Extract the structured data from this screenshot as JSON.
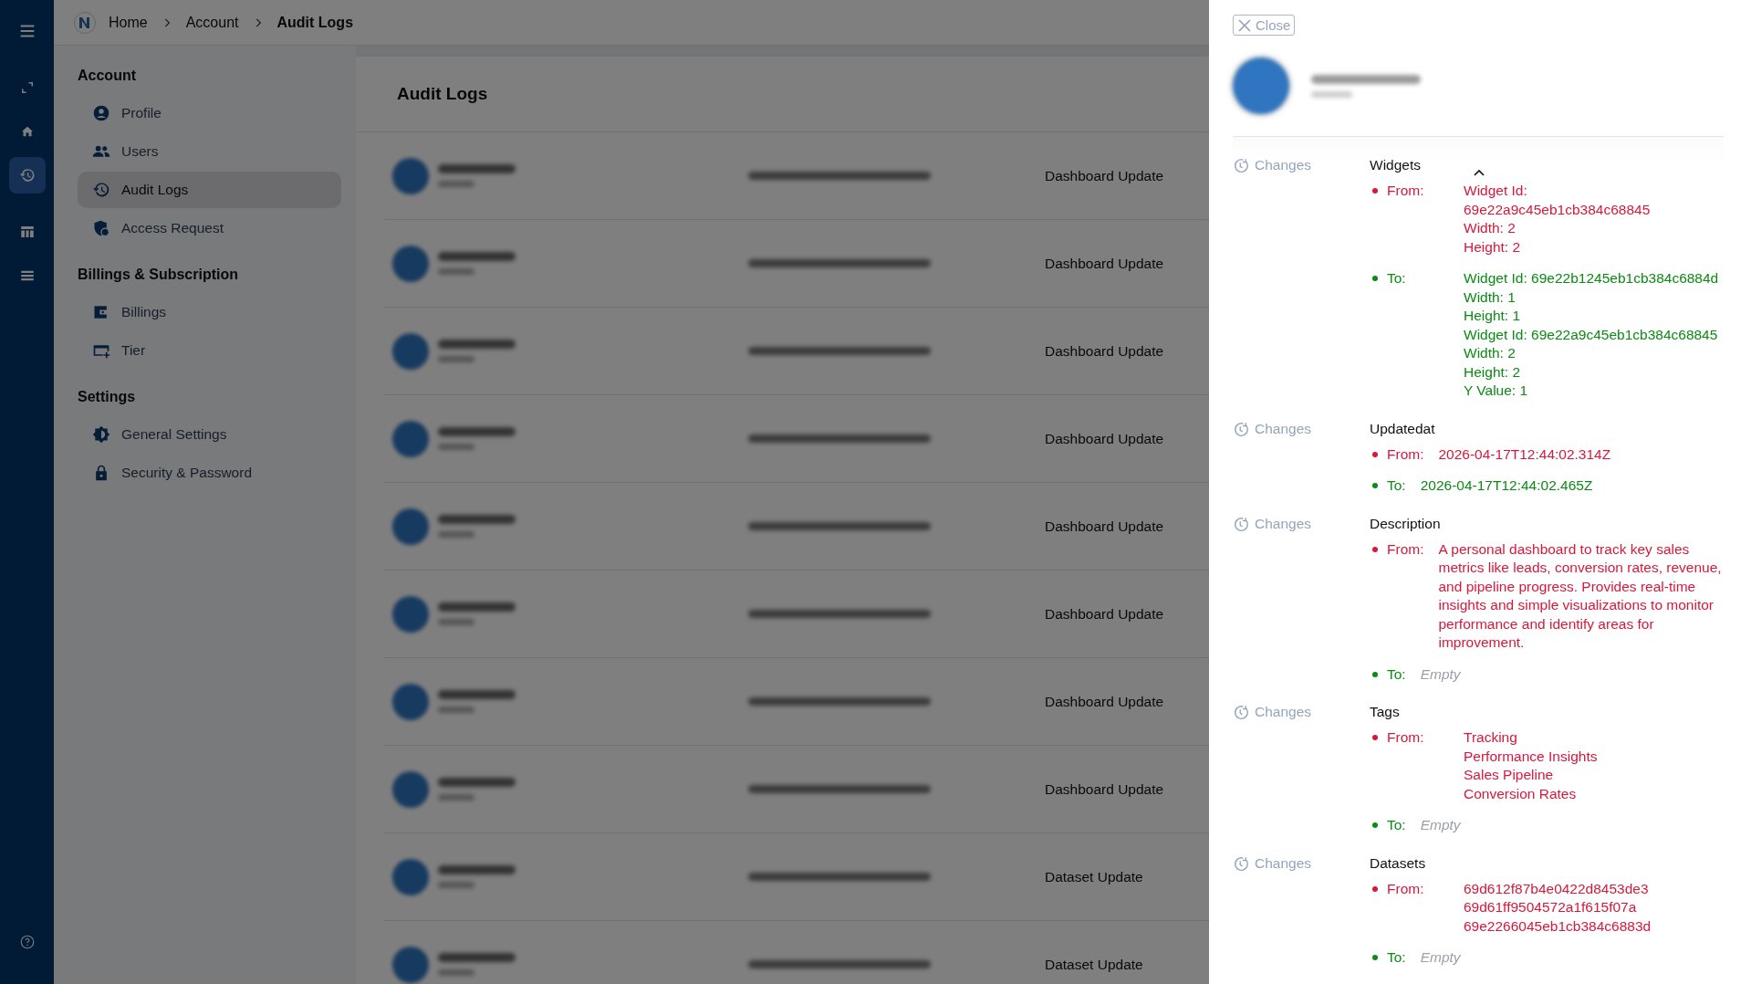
{
  "rail": [
    {
      "kind": "menu",
      "selected": false
    },
    {
      "kind": "expand",
      "selected": false
    },
    {
      "kind": "home",
      "selected": false
    },
    {
      "kind": "history",
      "selected": true
    },
    {
      "kind": "table",
      "selected": false
    },
    {
      "kind": "list",
      "selected": false
    },
    {
      "kind": "help",
      "selected": false
    }
  ],
  "breadcrumb": [
    {
      "label": "Home",
      "current": false
    },
    {
      "label": "Account",
      "current": false
    },
    {
      "label": "Audit Logs",
      "current": true
    }
  ],
  "sidebar": [
    {
      "title": "Account",
      "items": [
        {
          "label": "Profile",
          "kind": "profile",
          "selected": false
        },
        {
          "label": "Users",
          "kind": "users",
          "selected": false
        },
        {
          "label": "Audit Logs",
          "kind": "history",
          "selected": true
        },
        {
          "label": "Access Request",
          "kind": "shield",
          "selected": false
        }
      ]
    },
    {
      "title": "Billings & Subscription",
      "items": [
        {
          "label": "Billings",
          "kind": "wallet",
          "selected": false
        },
        {
          "label": "Tier",
          "kind": "card",
          "selected": false
        }
      ]
    },
    {
      "title": "Settings",
      "items": [
        {
          "label": "General Settings",
          "kind": "brightness",
          "selected": false
        },
        {
          "label": "Security & Password",
          "kind": "lock",
          "selected": false
        }
      ]
    }
  ],
  "main": {
    "title": "Audit Logs",
    "rows": [
      {
        "action": "Dashboard Update"
      },
      {
        "action": "Dashboard Update"
      },
      {
        "action": "Dashboard Update"
      },
      {
        "action": "Dashboard Update"
      },
      {
        "action": "Dashboard Update"
      },
      {
        "action": "Dashboard Update"
      },
      {
        "action": "Dashboard Update"
      },
      {
        "action": "Dashboard Update"
      },
      {
        "action": "Dataset Update"
      },
      {
        "action": "Dataset Update"
      }
    ]
  },
  "drawer": {
    "close_label": "Close",
    "changes": [
      {
        "label": "Changes",
        "field": "Widgets",
        "from": {
          "label": "From:",
          "kind": "value",
          "lines": [
            "Widget Id:",
            "69e22a9c45eb1cb384c68845",
            "Width: 2",
            "Height: 2"
          ]
        },
        "to": {
          "label": "To:",
          "kind": "value",
          "lines": [
            "Widget Id: 69e22b1245eb1cb384c6884d",
            "Width: 1",
            "Height: 1",
            "Widget Id: 69e22a9c45eb1cb384c68845",
            "Width: 2",
            "Height: 2",
            "Y Value: 1"
          ]
        }
      },
      {
        "label": "Changes",
        "field": "Updatedat",
        "from": {
          "label": "From:",
          "kind": "value",
          "lines": [
            "2026-04-17T12:44:02.314Z"
          ]
        },
        "to": {
          "label": "To:",
          "kind": "value",
          "lines": [
            "2026-04-17T12:44:02.465Z"
          ]
        }
      },
      {
        "label": "Changes",
        "field": "Description",
        "from": {
          "label": "From:",
          "kind": "value",
          "lines": [
            "A personal dashboard to track key sales metrics like leads, conversion rates, revenue, and pipeline progress. Provides real-time insights and simple visualizations to monitor performance and identify areas for improvement."
          ]
        },
        "to": {
          "label": "To:",
          "kind": "empty",
          "lines": [
            "Empty"
          ]
        }
      },
      {
        "label": "Changes",
        "field": "Tags",
        "from": {
          "label": "From:",
          "kind": "value",
          "lines": [
            "Tracking",
            "Performance Insights",
            "Sales Pipeline",
            "Conversion Rates"
          ]
        },
        "to": {
          "label": "To:",
          "kind": "empty",
          "lines": [
            "Empty"
          ]
        }
      },
      {
        "label": "Changes",
        "field": "Datasets",
        "from": {
          "label": "From:",
          "kind": "value",
          "lines": [
            "69d612f87b4e0422d8453de3",
            "69d61ff9504572a1f615f07a",
            "69e2266045eb1cb384c6883d"
          ]
        },
        "to": {
          "label": "To:",
          "kind": "empty",
          "lines": [
            "Empty"
          ]
        }
      }
    ]
  }
}
